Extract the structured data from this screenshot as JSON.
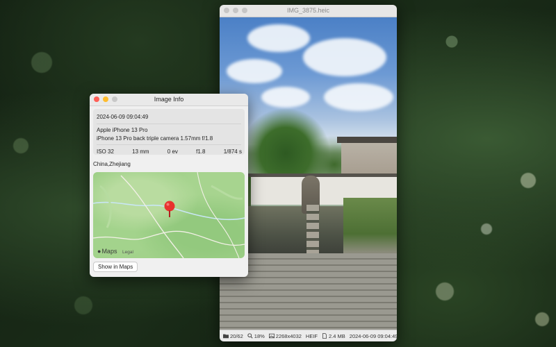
{
  "viewer": {
    "title": "IMG_3875.heic",
    "status": {
      "index": "20/62",
      "zoom": "18%",
      "dimensions": "2268x4032",
      "format": "HEIF",
      "size": "2.4 MB",
      "date": "2024-06-09 09:04:49"
    }
  },
  "info": {
    "title": "Image Info",
    "datetime": "2024-06-09 09:04:49",
    "device": "Apple iPhone 13 Pro",
    "lens": "iPhone 13 Pro back triple camera 1.57mm f/1.8",
    "exif": {
      "iso": "ISO 32",
      "focal": "13 mm",
      "ev": "0 ev",
      "aperture": "f1.8",
      "shutter": "1/874 s"
    },
    "location": "China,Zhejiang",
    "map": {
      "brand": "Maps",
      "legal": "Legal"
    },
    "show_button": "Show in Maps"
  },
  "colors": {
    "close": "#ff5f57",
    "minimize": "#febc2e",
    "pin": "#e8322f",
    "map_green": "#9fd088"
  }
}
